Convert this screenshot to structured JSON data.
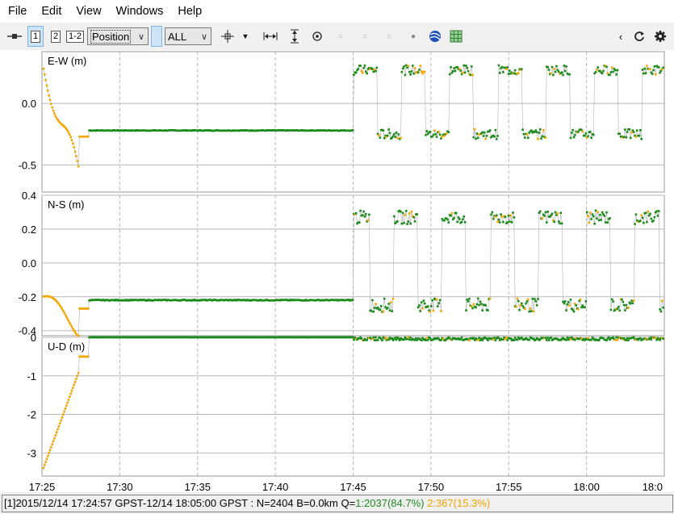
{
  "menu": [
    "File",
    "Edit",
    "View",
    "Windows",
    "Help"
  ],
  "toolbar": {
    "view1_label": "1",
    "view2_label": "2",
    "view12_label": "1-2",
    "plot_type": "Position",
    "quality": "ALL"
  },
  "colors": {
    "fix": "#1a8a1a",
    "float": "#f5a700",
    "grid": "#b8b8b8"
  },
  "chart_data": [
    {
      "type": "scatter",
      "ylabel": "E-W (m)",
      "ylim": [
        -0.72,
        0.42
      ],
      "yticks": [
        0.0,
        -0.5
      ],
      "ytick_labels": [
        "0.0",
        "-0.5"
      ],
      "baseline_fix": -0.22,
      "series": [
        {
          "name": "1",
          "values_desc": "fix"
        },
        {
          "name": "2",
          "values_desc": "float"
        }
      ]
    },
    {
      "type": "scatter",
      "ylabel": "N-S (m)",
      "ylim": [
        -0.43,
        0.4
      ],
      "yticks": [
        0.4,
        0.2,
        0.0,
        -0.2,
        -0.4
      ],
      "ytick_labels": [
        "0.4",
        "0.2",
        "0.0",
        "-0.2",
        "-0.4"
      ],
      "baseline_fix": -0.22
    },
    {
      "type": "scatter",
      "ylabel": "U-D (m)",
      "ylim": [
        -3.6,
        0.0
      ],
      "yticks": [
        0,
        -1,
        -2,
        -3
      ],
      "ytick_labels": [
        "0",
        "-1",
        "-2",
        "-3"
      ],
      "baseline_fix": 0.0
    }
  ],
  "xaxis": {
    "ticks": [
      "17:25",
      "17:30",
      "17:35",
      "17:40",
      "17:45",
      "17:50",
      "17:55",
      "18:00",
      "18:0"
    ],
    "xlim_minutes": [
      0,
      40
    ]
  },
  "status": {
    "prefix": "[1]2015/12/14 17:24:57 GPST-12/14 18:05:00 GPST : N=2404 B=0.0km Q=",
    "q1": "1:2037(84.7%)",
    "q2": "2:367(15.3%)"
  }
}
